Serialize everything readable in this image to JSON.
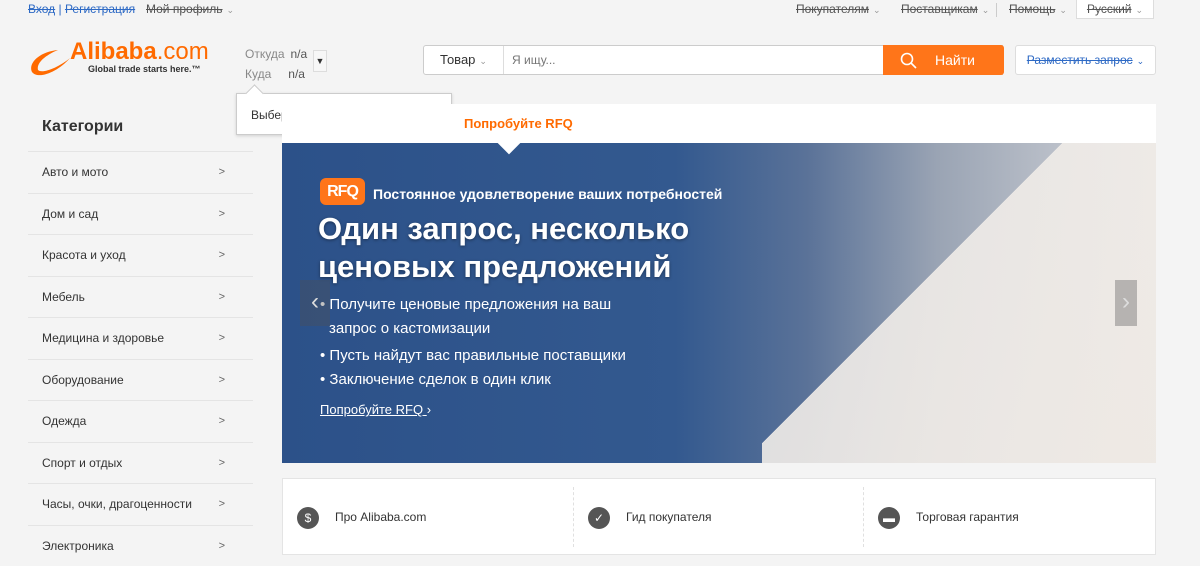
{
  "topbar": {
    "signin": "Вход",
    "register": "Регистрация",
    "profile": "Мой профиль",
    "buyers": "Покупателям",
    "suppliers": "Поставщикам",
    "help": "Помощь",
    "language": "Русский"
  },
  "logo": {
    "name": "Alibaba",
    "domain": ".com",
    "tagline": "Global trade starts here.™"
  },
  "shipping": {
    "from_label": "Откуда",
    "from_value": "n/a",
    "to_label": "Куда",
    "to_value": "n/a"
  },
  "tooltip": {
    "text": "Выберите товары и поставщиков",
    "close": "×"
  },
  "search": {
    "category": "Товар",
    "placeholder": "Я ищу...",
    "button": "Найти"
  },
  "post_request": "Разместить запрос",
  "sidebar": {
    "title": "Категории",
    "items": [
      {
        "label": "Авто и мото"
      },
      {
        "label": "Дом и сад"
      },
      {
        "label": "Красота и уход"
      },
      {
        "label": "Мебель"
      },
      {
        "label": "Медицина и здоровье"
      },
      {
        "label": "Оборудование"
      },
      {
        "label": "Одежда"
      },
      {
        "label": "Спорт и отдых"
      },
      {
        "label": "Часы, очки, драгоценности"
      },
      {
        "label": "Электроника"
      }
    ],
    "chevron": ">"
  },
  "panel": {
    "title": "Попробуйте RFQ"
  },
  "banner": {
    "badge": "RFQ",
    "subtitle": "Постоянное удовлетворение ваших потребностей",
    "headline1": "Один запрос, несколько",
    "headline2": "ценовых предложений",
    "bullet1a": "Получите ценовые предложения на ваш",
    "bullet1b": "запрос о кастомизации",
    "bullet2": "Пусть найдут вас правильные поставщики",
    "bullet3": "Заключение сделок в один клик",
    "link": "Попробуйте RFQ",
    "link_arrow": "›",
    "prev": "‹",
    "next": "›"
  },
  "info": {
    "items": [
      {
        "label": "Про Alibaba.com",
        "icon": "$"
      },
      {
        "label": "Гид покупателя",
        "icon": "✓"
      },
      {
        "label": "Торговая гарантия",
        "icon": "▬"
      }
    ]
  },
  "colors": {
    "accent": "#ff6a00",
    "link": "#2e6ac5",
    "banner": "#2c5189"
  }
}
